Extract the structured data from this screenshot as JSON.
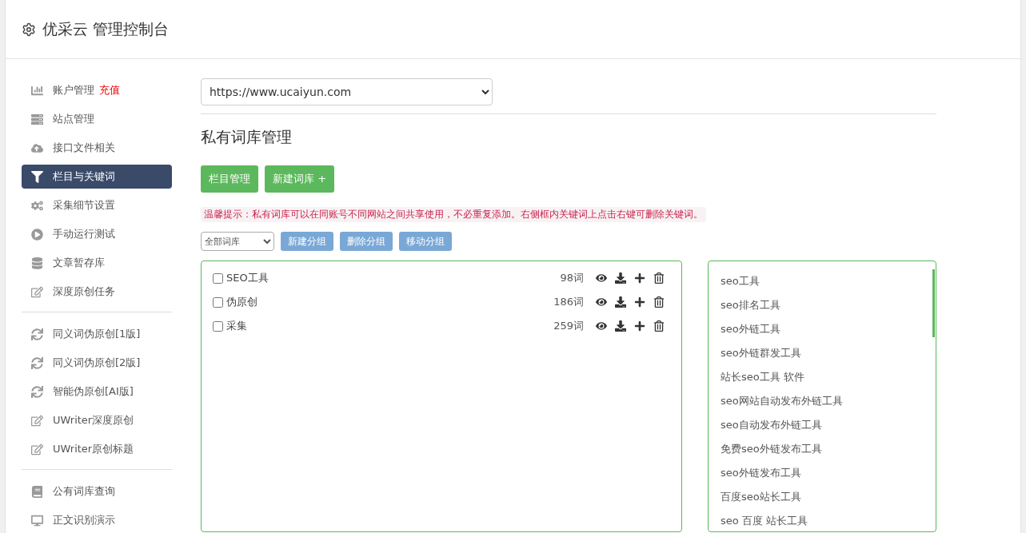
{
  "header": {
    "title": "优采云 管理控制台"
  },
  "sidebar": {
    "groups": [
      [
        {
          "label": "账户管理",
          "badge": "充值",
          "selected": false
        },
        {
          "label": "站点管理",
          "selected": false
        },
        {
          "label": "接口文件相关",
          "selected": false
        },
        {
          "label": "栏目与关键词",
          "selected": true
        },
        {
          "label": "采集细节设置",
          "selected": false
        },
        {
          "label": "手动运行测试",
          "selected": false
        },
        {
          "label": "文章暂存库",
          "selected": false
        },
        {
          "label": "深度原创任务",
          "selected": false
        }
      ],
      [
        {
          "label": "同义词伪原创[1版]",
          "selected": false
        },
        {
          "label": "同义词伪原创[2版]",
          "selected": false
        },
        {
          "label": "智能伪原创[AI版]",
          "selected": false
        },
        {
          "label": "UWriter深度原创",
          "selected": false
        },
        {
          "label": "UWriter原创标题",
          "selected": false
        }
      ],
      [
        {
          "label": "公有词库查询",
          "selected": false
        },
        {
          "label": "正文识别演示",
          "selected": false
        }
      ]
    ]
  },
  "site_select": {
    "value": "https://www.ucaiyun.com"
  },
  "heading": "私有词库管理",
  "buttons": [
    "栏目管理",
    "新建词库 +"
  ],
  "tip": "温馨提示：私有词库可以在同账号不同网站之间共享使用，不必重复添加。右侧框内关键词上点击右键可删除关键词。",
  "toolbar": {
    "filter": "全部词库",
    "buttons": [
      "新建分组",
      "删除分组",
      "移动分组"
    ]
  },
  "libraries": [
    {
      "name": "SEO工具",
      "count": "98词",
      "checked": false
    },
    {
      "name": "伪原创",
      "count": "186词",
      "checked": false
    },
    {
      "name": "采集",
      "count": "259词",
      "checked": false
    }
  ],
  "keywords": [
    "seo工具",
    "seo排名工具",
    "seo外链工具",
    "seo外链群发工具",
    "站长seo工具 软件",
    "seo网站自动发布外链工具",
    "seo自动发布外链工具",
    "免费seo外链发布工具",
    "seo外链发布工具",
    "百度seo站长工具",
    "seo 百度 站长工具"
  ]
}
